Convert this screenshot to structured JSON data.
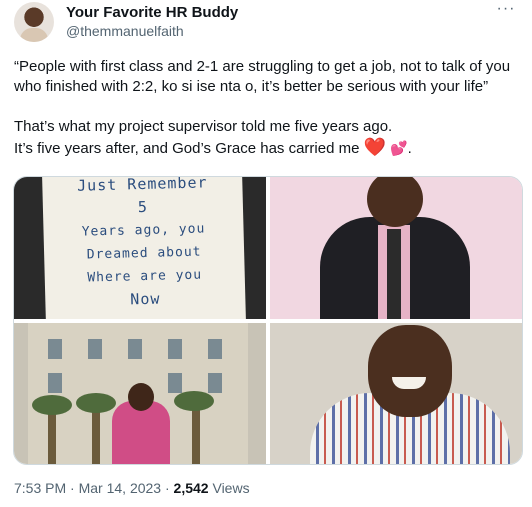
{
  "tweet": {
    "author_name": "Your Favorite HR Buddy",
    "author_handle": "@themmanuelfaith",
    "more_icon": "more-dots-icon",
    "text_paragraph_1": "“People with first class and 2-1 are struggling to get a job, not to talk of you who finished with 2:2, ko si ise nta o, it’s better be serious with your life”",
    "text_line_2a": "That’s what my project supervisor told me five years ago.",
    "text_line_2b": "It’s five years after, and God’s Grace has carried me",
    "emoji_1": "❤️",
    "emoji_2": "💕",
    "text_end": "."
  },
  "media": {
    "note_lines": [
      "Just Remember",
      "5",
      "Years ago, you",
      "Dreamed about",
      "Where are you",
      "Now"
    ]
  },
  "footer": {
    "time": "7:53 PM",
    "separator_1": " · ",
    "date": "Mar 14, 2023",
    "separator_2": " · ",
    "views_count": "2,542",
    "views_label": " Views"
  },
  "colors": {
    "text": "#0f1419",
    "secondary": "#536471",
    "heart": "#e0245e",
    "border": "#cfd9de"
  }
}
